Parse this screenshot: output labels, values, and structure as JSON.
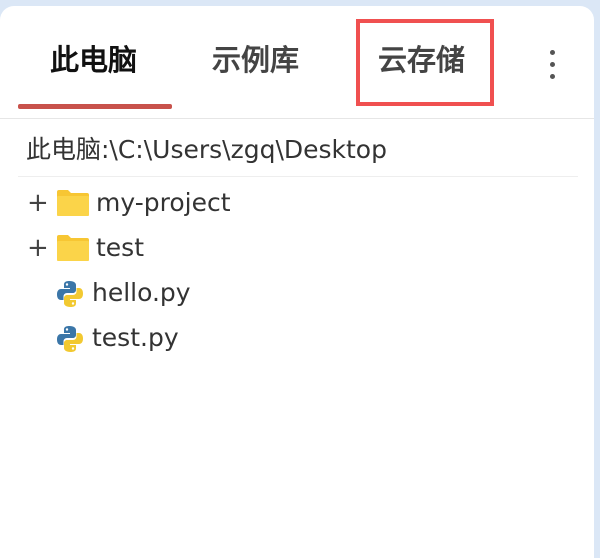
{
  "tabs": [
    {
      "label": "此电脑",
      "active": true
    },
    {
      "label": "示例库",
      "active": false
    },
    {
      "label": "云存储",
      "active": false,
      "highlighted": true
    }
  ],
  "more_menu_icon": "vertical-ellipsis-icon",
  "path": "此电脑:\\C:\\Users\\zgq\\Desktop",
  "tree": [
    {
      "name": "my-project",
      "type": "folder",
      "expandable": true,
      "icon": "folder-icon"
    },
    {
      "name": "test",
      "type": "folder",
      "expandable": true,
      "icon": "folder-icon"
    },
    {
      "name": "hello.py",
      "type": "file",
      "expandable": false,
      "icon": "python-file-icon"
    },
    {
      "name": "test.py",
      "type": "file",
      "expandable": false,
      "icon": "python-file-icon"
    }
  ],
  "expand_symbol": "+",
  "colors": {
    "active_tab_underline": "#c8524b",
    "highlight_box": "#f05050",
    "folder": "#f7c633",
    "python_blue": "#3b76a8",
    "python_yellow": "#f2c931",
    "background": "#dbe7f6"
  }
}
